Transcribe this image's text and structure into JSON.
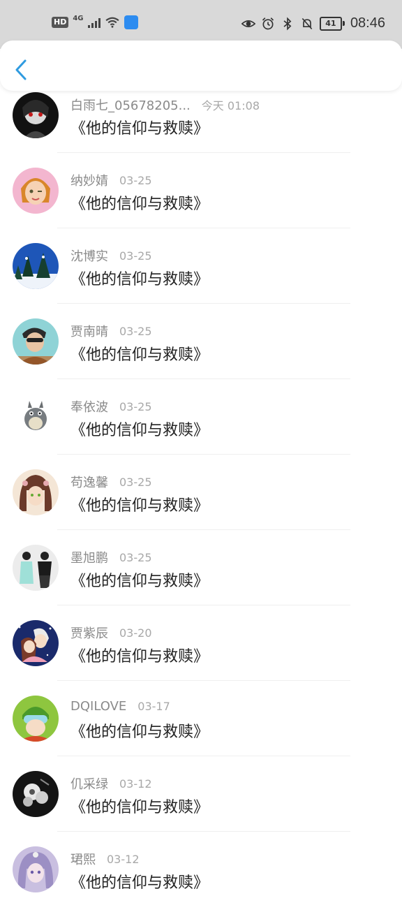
{
  "status_bar": {
    "hd": "HD",
    "network": "4G",
    "battery": "41",
    "time": "08:46"
  },
  "header": {
    "back_icon": "chevron-left-icon",
    "accent": "#2f9be0"
  },
  "items": [
    {
      "name": "白雨七_05678205...",
      "date": "今天 01:08",
      "title": "《他的信仰与救赎》"
    },
    {
      "name": "纳妙婧",
      "date": "03-25",
      "title": "《他的信仰与救赎》"
    },
    {
      "name": "沈博实",
      "date": "03-25",
      "title": "《他的信仰与救赎》"
    },
    {
      "name": "贾南晴",
      "date": "03-25",
      "title": "《他的信仰与救赎》"
    },
    {
      "name": "奉依波",
      "date": "03-25",
      "title": "《他的信仰与救赎》"
    },
    {
      "name": "苟逸馨",
      "date": "03-25",
      "title": "《他的信仰与救赎》"
    },
    {
      "name": "墨旭鹏",
      "date": "03-25",
      "title": "《他的信仰与救赎》"
    },
    {
      "name": "贾紫辰",
      "date": "03-20",
      "title": "《他的信仰与救赎》"
    },
    {
      "name": "DQILOVE",
      "date": "03-17",
      "title": "《他的信仰与救赎》"
    },
    {
      "name": "仉采绿",
      "date": "03-12",
      "title": "《他的信仰与救赎》"
    },
    {
      "name": "珺熙",
      "date": "03-12",
      "title": "《他的信仰与救赎》"
    }
  ]
}
